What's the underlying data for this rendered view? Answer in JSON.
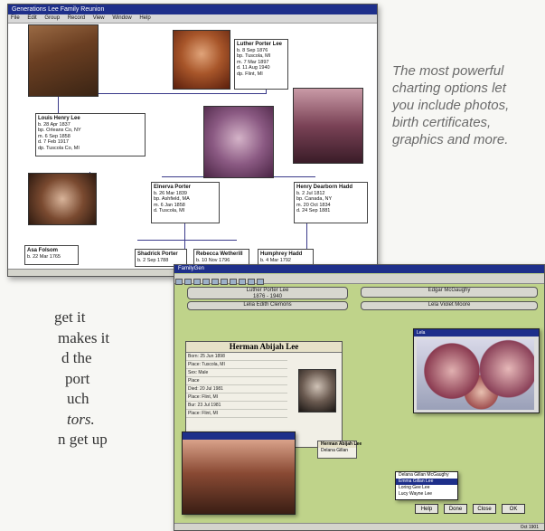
{
  "window1": {
    "title": "Generations Lee Family Reunion",
    "menu": [
      "File",
      "Edit",
      "Group",
      "Record",
      "View",
      "Window",
      "Help"
    ],
    "boxes": {
      "luther": [
        "Luther Porter Lee",
        "b. 8 Sep 1876",
        "bp. Tuscola, MI",
        "m. 7 Mar 1897",
        "d. 11 Aug 1940",
        "dp. Flint, MI"
      ],
      "louis": [
        "Louis Henry Lee",
        "b. 28 Apr 1837",
        "bp. Orleans Co, NY",
        "m. 6 Sep 1858",
        "d. 7 Feb 1917",
        "dp. Tuscola Co, MI"
      ],
      "elnerva": [
        "Elnerva Porter",
        "b. 26 Mar 1839",
        "bp. Ashfield, MA",
        "m. 6 Jan 1858",
        "d. Tuscola, MI"
      ],
      "henry": [
        "Henry Dearborn Hadd",
        "b. 2 Jul 1812",
        "bp. Canada, NY",
        "m. 20 Oct 1834",
        "d. 24 Sep 1881"
      ],
      "asa": [
        "Asa Folsom",
        "b. 22 Mar 1765"
      ],
      "shadrick": [
        "Shadrick Porter",
        "b. 2 Sep 1788"
      ],
      "rebecca": [
        "Rebecca Wetherill",
        "b. 10 Nov 1796"
      ],
      "humphrey": [
        "Humphrey Hadd",
        "b. 4 Mar 1792"
      ]
    }
  },
  "caption": [
    "The most powerful",
    "charting options let",
    "you include photos,",
    "birth certificates,",
    "graphics and more."
  ],
  "bodytext": [
    "get it",
    "makes it",
    "d the",
    "port",
    "uch",
    "tors.",
    "n get up"
  ],
  "window2": {
    "title": "FamilyGen",
    "bars": [
      "Luther Porter Lee",
      "1876 - 1940",
      "Lelia Edith Clemons",
      "Edgar McGaughy",
      "Lela Violet Moore"
    ],
    "record_name": "Herman Abijah Lee",
    "fields": [
      "Born: 25 Jun 1898",
      "Place: Tuscola, MI",
      "Sex: Male",
      "Place",
      "Died: 20 Jul 1981",
      "Place: Flint, MI",
      "Bur: 23 Jul 1981",
      "Place: Flint, MI"
    ],
    "photo_window_title": "Lela",
    "list_items": [
      "Delana Gillan McGaughy",
      "Emma Gillan Lee",
      "Loring Gee Lee",
      "Lucy Wayne Lee"
    ],
    "left_list": [
      "Herman Abijah Lee",
      "Delana Gillan"
    ],
    "buttons": [
      "Help",
      "Done",
      "Close",
      "OK"
    ],
    "status": "Oct 1901"
  }
}
